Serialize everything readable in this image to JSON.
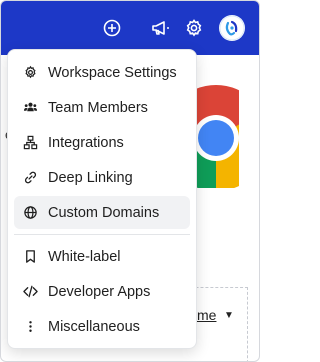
{
  "topbar": {
    "icons": [
      "plus-circle-icon",
      "megaphone-icon",
      "gear-icon",
      "avatar"
    ],
    "color": "#1d38c7"
  },
  "background": {
    "partial_text": "e",
    "link_text": "me"
  },
  "menu": {
    "group1": [
      {
        "label": "Workspace Settings",
        "icon": "gear-icon"
      },
      {
        "label": "Team Members",
        "icon": "team-icon"
      },
      {
        "label": "Integrations",
        "icon": "integrations-icon"
      },
      {
        "label": "Deep Linking",
        "icon": "link-icon"
      },
      {
        "label": "Custom Domains",
        "icon": "globe-icon",
        "active": true
      }
    ],
    "group2": [
      {
        "label": "White-label",
        "icon": "bookmark-icon"
      },
      {
        "label": "Developer Apps",
        "icon": "code-icon"
      },
      {
        "label": "Miscellaneous",
        "icon": "more-vertical-icon"
      }
    ]
  }
}
